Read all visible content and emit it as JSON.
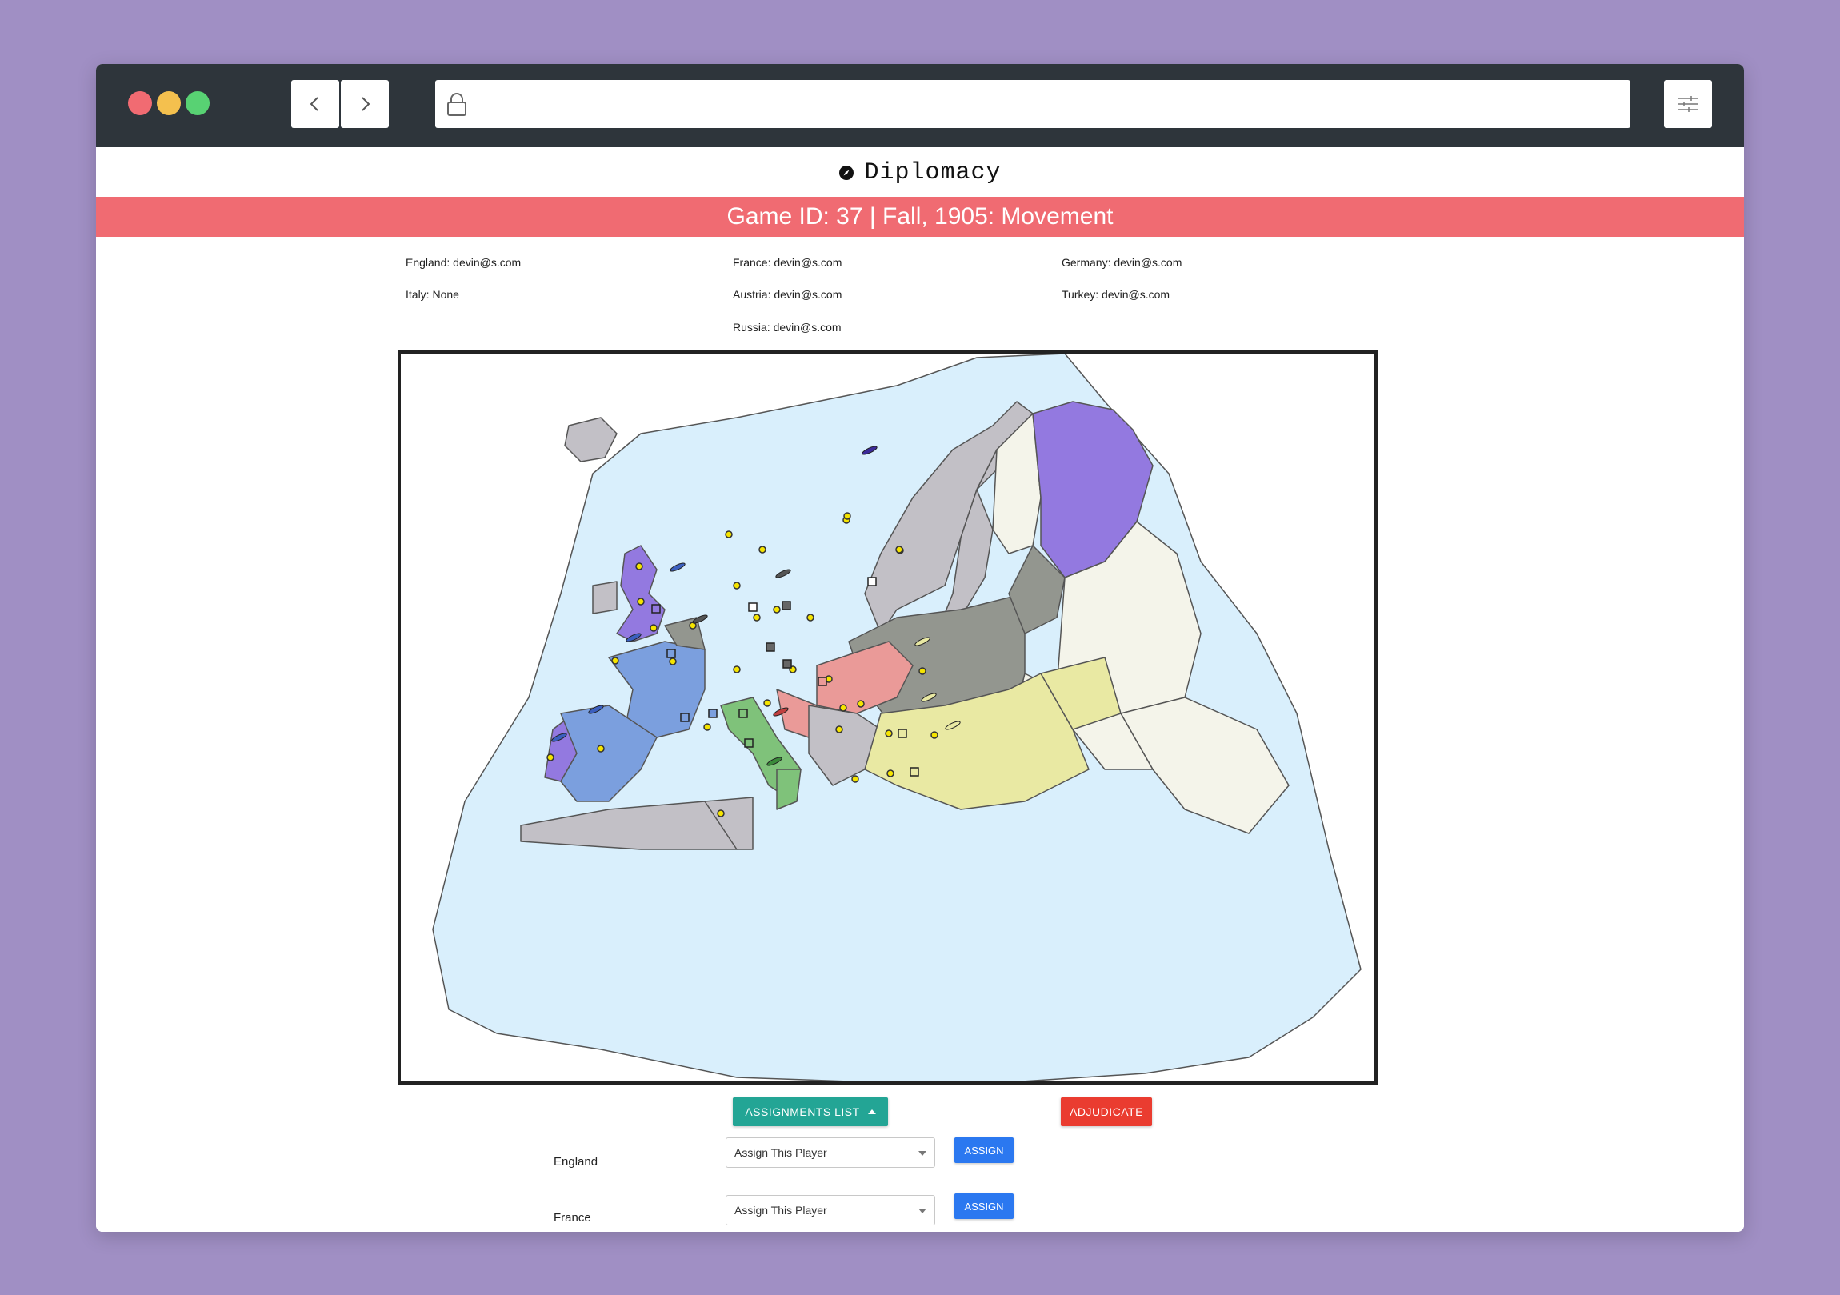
{
  "brand": {
    "title": "Diplomacy",
    "icon": "compass-icon"
  },
  "banner": {
    "text": "Game ID: 37 | Fall, 1905: Movement"
  },
  "players": [
    {
      "label": "England: devin@s.com"
    },
    {
      "label": "France: devin@s.com"
    },
    {
      "label": "Germany: devin@s.com"
    },
    {
      "label": "Italy: None"
    },
    {
      "label": "Austria: devin@s.com"
    },
    {
      "label": "Turkey: devin@s.com"
    },
    {
      "label": "Russia: devin@s.com"
    }
  ],
  "powers": {
    "england": "#9379e0",
    "france": "#7b9fde",
    "germany": "#93968f",
    "italy": "#7fc27a",
    "austria": "#ea9a98",
    "turkey": "#e9e9a3",
    "russia": "#f4f4ea",
    "neutral": "#c2c0c6",
    "sea": "#d9effc"
  },
  "controls": {
    "assignments_label": "Assignments List",
    "adjudicate_label": "Adjudicate"
  },
  "assignments": [
    {
      "power": "England",
      "select_value": "Assign This Player",
      "button": "Assign"
    },
    {
      "power": "France",
      "select_value": "Assign This Player",
      "button": "Assign"
    }
  ]
}
